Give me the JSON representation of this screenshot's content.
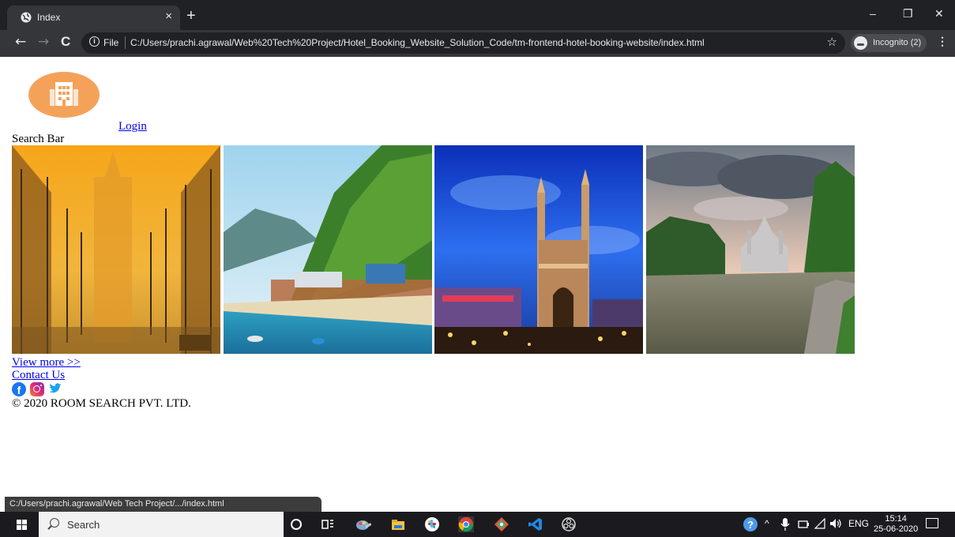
{
  "browser": {
    "tab_title": "Index",
    "tab_close": "×",
    "new_tab": "+",
    "window_controls": {
      "minimize": "–",
      "restore": "❐",
      "close": "✕"
    },
    "nav": {
      "back": "←",
      "forward": "→",
      "reload": "C"
    },
    "address_scheme": "File",
    "address_url": "C:/Users/prachi.agrawal/Web%20Tech%20Project/Hotel_Booking_Website_Solution_Code/tm-frontend-hotel-booking-website/index.html",
    "bookmark_star": "☆",
    "incognito_label": "Incognito (2)",
    "menu": "⋮",
    "status_url": "C:/Users/prachi.agrawal/Web Tech Project/.../index.html"
  },
  "page": {
    "login_link": "Login",
    "search_bar_text": "Search Bar",
    "gallery": [
      {
        "name": "india-gate",
        "accent": "#f2a51c"
      },
      {
        "name": "beach-palms",
        "accent": "#3f8f3a"
      },
      {
        "name": "charminar-night",
        "accent": "#1a4fd8"
      },
      {
        "name": "lake-palace",
        "accent": "#7d8f9c"
      }
    ],
    "view_more_link": "View more >>",
    "contact_link": "Contact Us",
    "social": [
      {
        "name": "facebook-icon",
        "color": "#1877f2"
      },
      {
        "name": "instagram-icon",
        "color": "#dd2a7b"
      },
      {
        "name": "twitter-icon",
        "color": "#1da1f2"
      }
    ],
    "copyright": "© 2020 ROOM SEARCH PVT. LTD."
  },
  "taskbar": {
    "search_placeholder": "Search",
    "language": "ENG",
    "time": "15:14",
    "date": "25-06-2020"
  }
}
